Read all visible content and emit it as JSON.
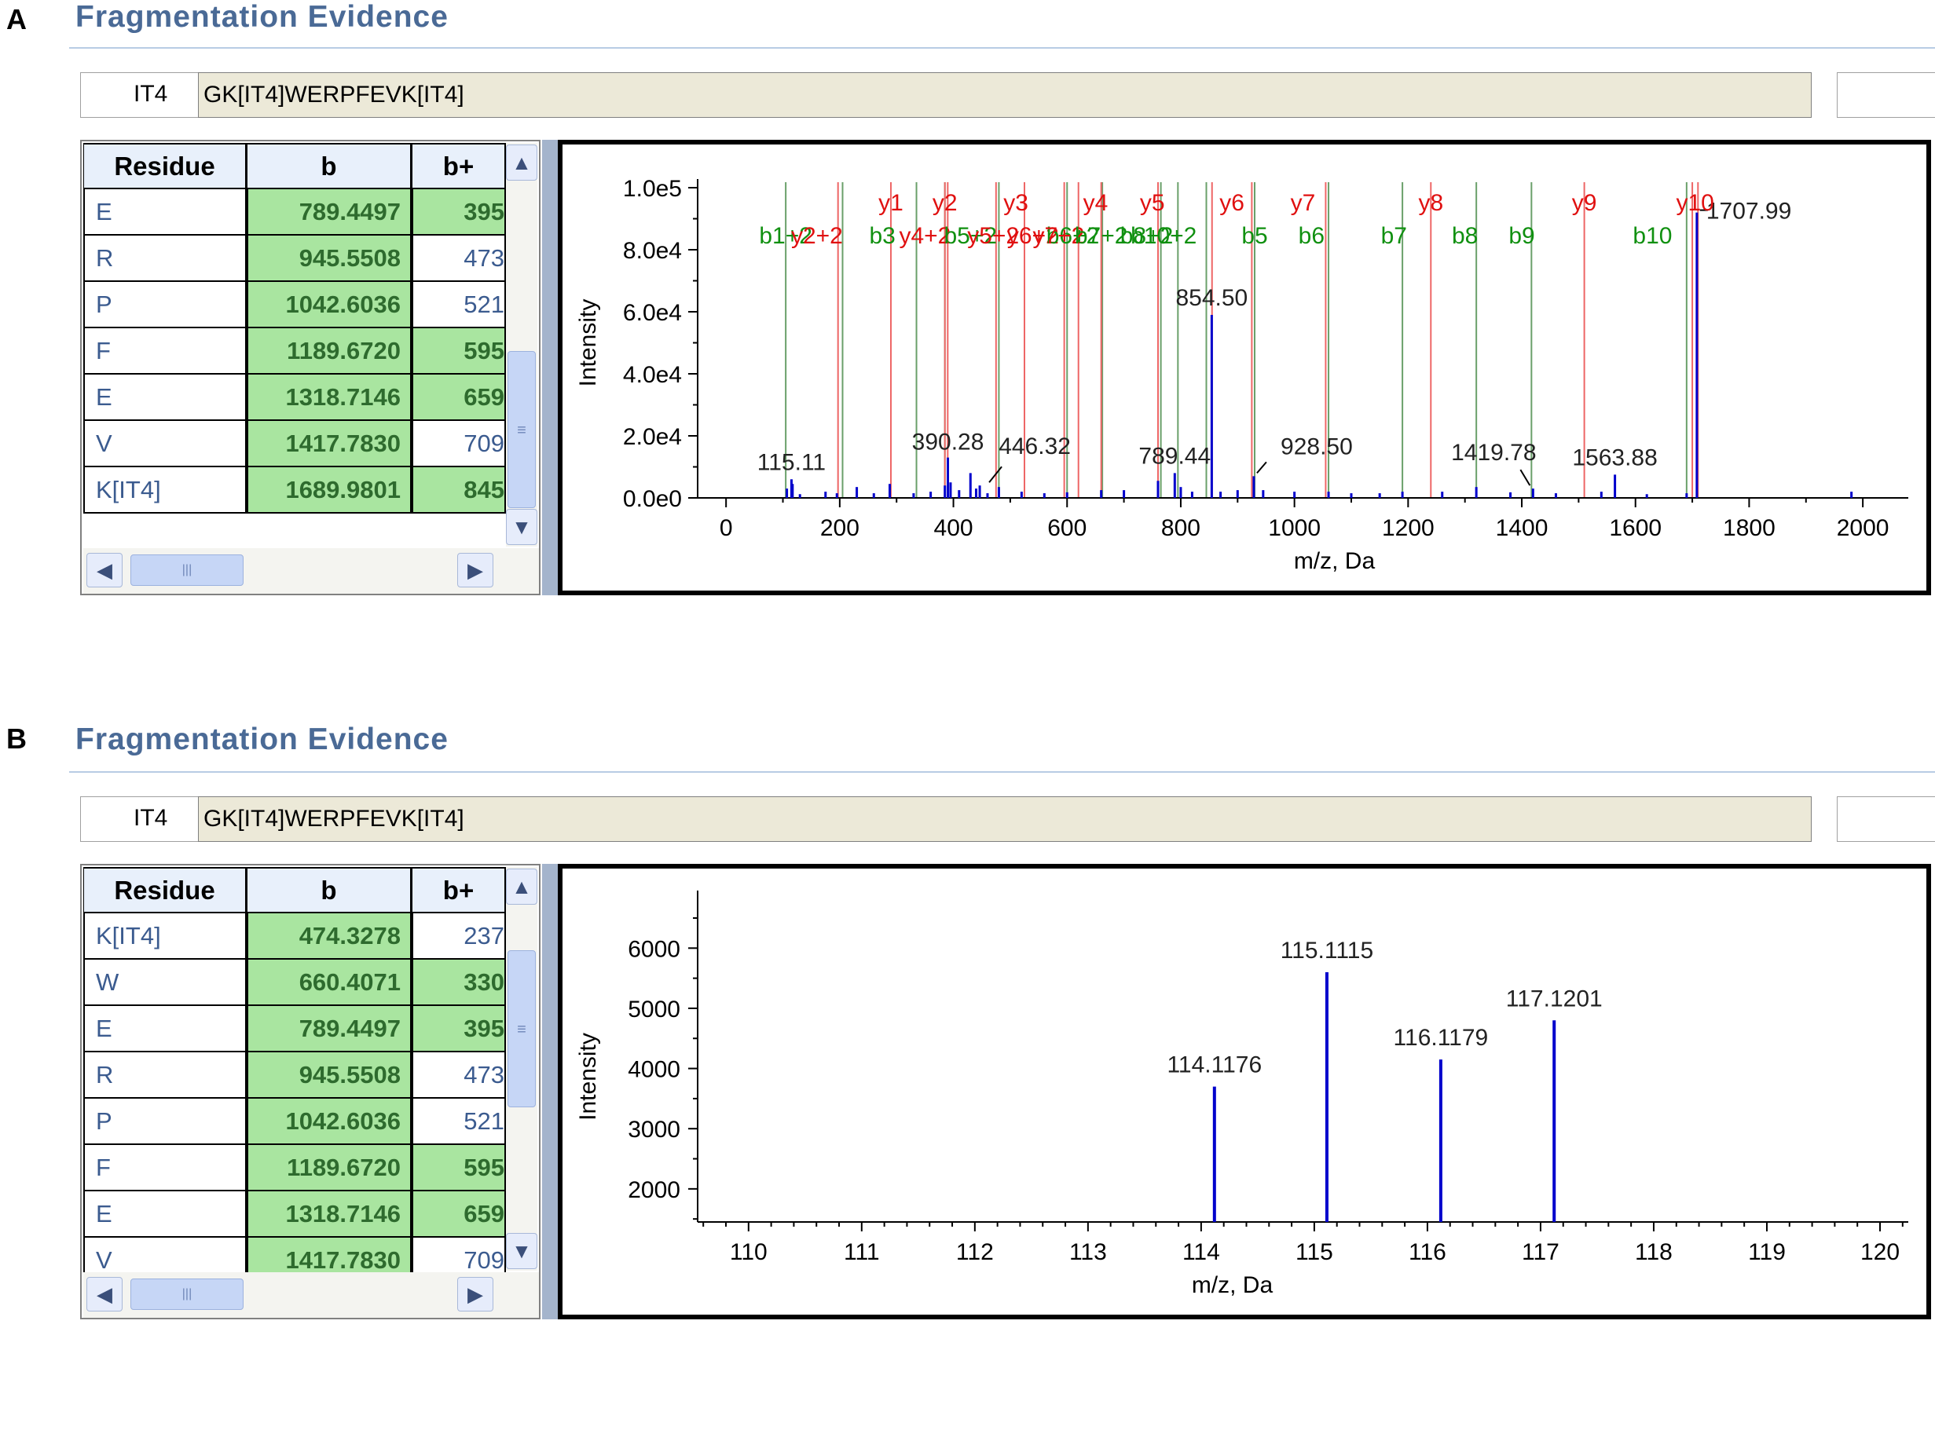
{
  "panels": [
    {
      "letter": "A",
      "title": "Fragmentation Evidence",
      "id_label": "IT4",
      "sequence": "GK[IT4]WERPFEVK[IT4]",
      "table": {
        "headers": [
          "Residue",
          "b",
          "b+"
        ],
        "rows": [
          {
            "residue": "E",
            "b": "789.4497",
            "b2": "395",
            "b2_highlight": true
          },
          {
            "residue": "R",
            "b": "945.5508",
            "b2": "473",
            "b2_highlight": false
          },
          {
            "residue": "P",
            "b": "1042.6036",
            "b2": "521",
            "b2_highlight": false
          },
          {
            "residue": "F",
            "b": "1189.6720",
            "b2": "595",
            "b2_highlight": true
          },
          {
            "residue": "E",
            "b": "1318.7146",
            "b2": "659",
            "b2_highlight": true
          },
          {
            "residue": "V",
            "b": "1417.7830",
            "b2": "709",
            "b2_highlight": false
          },
          {
            "residue": "K[IT4]",
            "b": "1689.9801",
            "b2": "845",
            "b2_highlight": true
          }
        ]
      }
    },
    {
      "letter": "B",
      "title": "Fragmentation Evidence",
      "id_label": "IT4",
      "sequence": "GK[IT4]WERPFEVK[IT4]",
      "table": {
        "headers": [
          "Residue",
          "b",
          "b+"
        ],
        "rows": [
          {
            "residue": "K[IT4]",
            "b": "474.3278",
            "b2": "237",
            "b2_highlight": false
          },
          {
            "residue": "W",
            "b": "660.4071",
            "b2": "330",
            "b2_highlight": true
          },
          {
            "residue": "E",
            "b": "789.4497",
            "b2": "395",
            "b2_highlight": true
          },
          {
            "residue": "R",
            "b": "945.5508",
            "b2": "473",
            "b2_highlight": false
          },
          {
            "residue": "P",
            "b": "1042.6036",
            "b2": "521",
            "b2_highlight": false
          },
          {
            "residue": "F",
            "b": "1189.6720",
            "b2": "595",
            "b2_highlight": true
          },
          {
            "residue": "E",
            "b": "1318.7146",
            "b2": "659",
            "b2_highlight": true
          },
          {
            "residue": "V",
            "b": "1417.7830",
            "b2": "709",
            "b2_highlight": false
          }
        ]
      }
    }
  ],
  "chart_data": [
    {
      "type": "bar",
      "xlabel": "m/z, Da",
      "ylabel": "Intensity",
      "xlim": [
        -50,
        2080
      ],
      "ylim": [
        0,
        100000
      ],
      "xticks": [
        0,
        200,
        400,
        600,
        800,
        1000,
        1200,
        1400,
        1600,
        1800,
        2000
      ],
      "yticks": [
        0,
        20000,
        40000,
        60000,
        80000,
        100000
      ],
      "ytick_labels": [
        "0.0e0",
        "2.0e4",
        "4.0e4",
        "6.0e4",
        "8.0e4",
        "1.0e5"
      ],
      "peaks": [
        {
          "x": 107,
          "y": 3000
        },
        {
          "x": 115.11,
          "y": 6000
        },
        {
          "x": 117,
          "y": 4500
        },
        {
          "x": 130,
          "y": 1200
        },
        {
          "x": 175,
          "y": 2000
        },
        {
          "x": 195,
          "y": 1500
        },
        {
          "x": 230,
          "y": 3500
        },
        {
          "x": 260,
          "y": 1500
        },
        {
          "x": 288,
          "y": 4500
        },
        {
          "x": 330,
          "y": 1500
        },
        {
          "x": 360,
          "y": 2000
        },
        {
          "x": 385,
          "y": 4000
        },
        {
          "x": 390.28,
          "y": 13000
        },
        {
          "x": 395,
          "y": 5000
        },
        {
          "x": 410,
          "y": 2500
        },
        {
          "x": 430,
          "y": 8000
        },
        {
          "x": 440,
          "y": 3000
        },
        {
          "x": 446.32,
          "y": 4000
        },
        {
          "x": 460,
          "y": 1500
        },
        {
          "x": 480,
          "y": 3500
        },
        {
          "x": 520,
          "y": 2000
        },
        {
          "x": 560,
          "y": 1500
        },
        {
          "x": 600,
          "y": 1800
        },
        {
          "x": 660,
          "y": 2500
        },
        {
          "x": 700,
          "y": 2500
        },
        {
          "x": 760,
          "y": 5500
        },
        {
          "x": 789.44,
          "y": 8000
        },
        {
          "x": 800,
          "y": 3500
        },
        {
          "x": 820,
          "y": 2000
        },
        {
          "x": 854.5,
          "y": 59000
        },
        {
          "x": 870,
          "y": 2000
        },
        {
          "x": 900,
          "y": 2500
        },
        {
          "x": 928.5,
          "y": 7000
        },
        {
          "x": 945,
          "y": 2500
        },
        {
          "x": 1000,
          "y": 2000
        },
        {
          "x": 1060,
          "y": 2000
        },
        {
          "x": 1100,
          "y": 1500
        },
        {
          "x": 1150,
          "y": 1500
        },
        {
          "x": 1190,
          "y": 2000
        },
        {
          "x": 1260,
          "y": 2000
        },
        {
          "x": 1320,
          "y": 3500
        },
        {
          "x": 1380,
          "y": 1800
        },
        {
          "x": 1419.78,
          "y": 3000
        },
        {
          "x": 1460,
          "y": 1500
        },
        {
          "x": 1540,
          "y": 2000
        },
        {
          "x": 1563.88,
          "y": 7500
        },
        {
          "x": 1620,
          "y": 1200
        },
        {
          "x": 1690,
          "y": 1500
        },
        {
          "x": 1707.99,
          "y": 92000
        },
        {
          "x": 1980,
          "y": 2000
        }
      ],
      "peak_labels": [
        {
          "x": 115.11,
          "y": 6000,
          "text": "115.11"
        },
        {
          "x": 390.28,
          "y": 13000,
          "text": "390.28"
        },
        {
          "x": 446.32,
          "y": 4000,
          "text": "446.32"
        },
        {
          "x": 789.44,
          "y": 8000,
          "text": "789.44"
        },
        {
          "x": 854.5,
          "y": 59000,
          "text": "854.50"
        },
        {
          "x": 928.5,
          "y": 7000,
          "text": "928.50"
        },
        {
          "x": 1419.78,
          "y": 3000,
          "text": "1419.78"
        },
        {
          "x": 1563.88,
          "y": 7500,
          "text": "1563.88"
        },
        {
          "x": 1707.99,
          "y": 92000,
          "text": "1707.99"
        }
      ],
      "b_ions": [
        {
          "x": 105,
          "label": "b1+2"
        },
        {
          "x": 205,
          "label": "b2+2"
        },
        {
          "x": 335,
          "label": "b3"
        },
        {
          "x": 385,
          "label": "b4+2"
        },
        {
          "x": 480,
          "label": "b5+2"
        },
        {
          "x": 600,
          "label": "b6+2"
        },
        {
          "x": 662,
          "label": "b7+2"
        },
        {
          "x": 765,
          "label": "b8+2"
        },
        {
          "x": 795,
          "label": "b9+2"
        },
        {
          "x": 845,
          "label": "b10+2"
        },
        {
          "x": 930,
          "label": "b5"
        },
        {
          "x": 1060,
          "label": "b6"
        },
        {
          "x": 1190,
          "label": "b7"
        },
        {
          "x": 1320,
          "label": "b8"
        },
        {
          "x": 1417,
          "label": "b9"
        },
        {
          "x": 1690,
          "label": "b10"
        }
      ],
      "y_ions": [
        {
          "x": 197,
          "label": "y2+2"
        },
        {
          "x": 290,
          "label": "y1"
        },
        {
          "x": 385,
          "label": "y2"
        },
        {
          "x": 390,
          "label": "y3+2"
        },
        {
          "x": 475,
          "label": "y4+2"
        },
        {
          "x": 525,
          "label": "y5+2"
        },
        {
          "x": 595,
          "label": "y6+2"
        },
        {
          "x": 620,
          "label": "y3"
        },
        {
          "x": 660,
          "label": "y7+2"
        },
        {
          "x": 760,
          "label": "y4"
        },
        {
          "x": 855,
          "label": "y5"
        },
        {
          "x": 925,
          "label": "y8+2"
        },
        {
          "x": 1055,
          "label": "y6"
        },
        {
          "x": 1240,
          "label": "y7"
        },
        {
          "x": 1510,
          "label": "y8"
        },
        {
          "x": 1700,
          "label": "y9"
        },
        {
          "x": 1710,
          "label": "y10"
        }
      ],
      "row1_labels": [
        "y1",
        "y2",
        "y3",
        "y4",
        "y5",
        "y6",
        "y7",
        "y8",
        "y9",
        "y10"
      ],
      "row2_labels": [
        "b1+2",
        "y2+2",
        "b3",
        "y4+2",
        "b5+2",
        "y5+2",
        "y6+2",
        "b6+2",
        "y7+2",
        "b7+2",
        "b8+2",
        "b10+2",
        "b5",
        "b6",
        "b7",
        "b8",
        "b9",
        "b10"
      ]
    },
    {
      "type": "bar",
      "xlabel": "m/z, Da",
      "ylabel": "Intensity",
      "xlim": [
        109.55,
        120.25
      ],
      "ylim": [
        1450,
        6800
      ],
      "xticks": [
        110,
        111,
        112,
        113,
        114,
        115,
        116,
        117,
        118,
        119,
        120
      ],
      "yticks": [
        2000,
        3000,
        4000,
        5000,
        6000
      ],
      "peaks": [
        {
          "x": 114.1176,
          "y": 3700,
          "label": "114.1176"
        },
        {
          "x": 115.1115,
          "y": 5600,
          "label": "115.1115"
        },
        {
          "x": 116.1179,
          "y": 4150,
          "label": "116.1179"
        },
        {
          "x": 117.1201,
          "y": 4800,
          "label": "117.1201"
        }
      ]
    }
  ]
}
